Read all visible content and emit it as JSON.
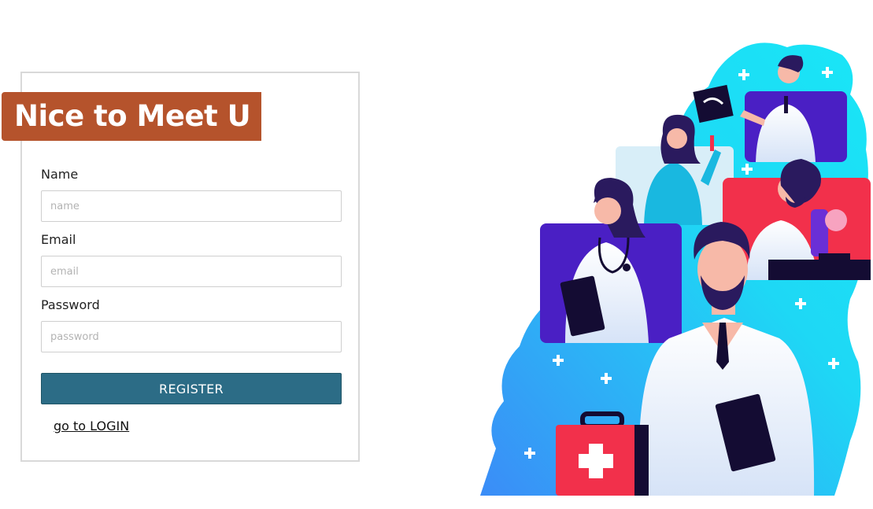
{
  "form": {
    "heading": "Nice to Meet U",
    "name_label": "Name",
    "name_placeholder": "name",
    "email_label": "Email",
    "email_placeholder": "email",
    "password_label": "Password",
    "password_placeholder": "password",
    "register_label": "REGISTER",
    "login_link": "go to LOGIN"
  },
  "colors": {
    "heading_bg": "#b5532c",
    "button_bg": "#2c6c86",
    "illustration_cyan": "#1ed8f5",
    "illustration_blue": "#3b8cf7",
    "panel_purple": "#4a1fc4",
    "panel_red": "#f2304b"
  },
  "illustration": {
    "subject": "medical-staff-illustration"
  }
}
